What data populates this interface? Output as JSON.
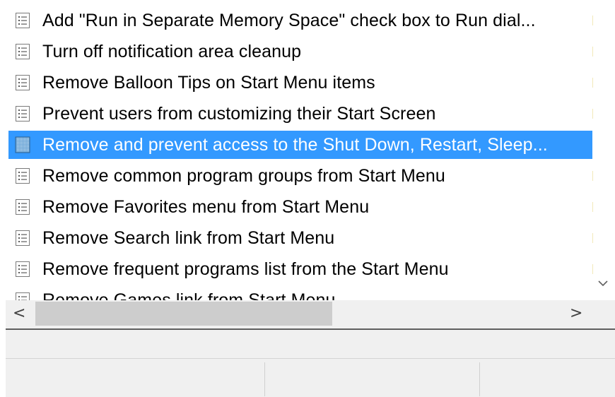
{
  "policy_list": {
    "items": [
      {
        "label": "Add \"Run in Separate Memory Space\" check box to Run dial...",
        "icon": "policy-setting-icon",
        "selected": false
      },
      {
        "label": "Turn off notification area cleanup",
        "icon": "policy-setting-icon",
        "selected": false
      },
      {
        "label": "Remove Balloon Tips on Start Menu items",
        "icon": "policy-setting-icon",
        "selected": false
      },
      {
        "label": "Prevent users from customizing their Start Screen",
        "icon": "policy-setting-icon",
        "selected": false
      },
      {
        "label": "Remove and prevent access to the Shut Down, Restart, Sleep...",
        "icon": "policy-setting-icon",
        "selected": true
      },
      {
        "label": "Remove common program groups from Start Menu",
        "icon": "policy-setting-icon",
        "selected": false
      },
      {
        "label": "Remove Favorites menu from Start Menu",
        "icon": "policy-setting-icon",
        "selected": false
      },
      {
        "label": "Remove Search link from Start Menu",
        "icon": "policy-setting-icon",
        "selected": false
      },
      {
        "label": "Remove frequent programs list from the Start Menu",
        "icon": "policy-setting-icon",
        "selected": false
      },
      {
        "label": "Remove Games link from Start Menu",
        "icon": "policy-setting-icon",
        "selected": false
      }
    ]
  },
  "scrollbars": {
    "horizontal": {
      "left_arrow": "<",
      "right_arrow": ">",
      "left_icon": "chevron-left-icon",
      "right_icon": "chevron-right-icon"
    },
    "vertical": {
      "down_arrow": "⌄",
      "down_icon": "chevron-down-icon"
    }
  },
  "colors": {
    "selection": "#3399ff",
    "scrollbar_track": "#f0f0f0",
    "scrollbar_thumb": "#cdcdcd"
  },
  "statusbar": {
    "panes": [
      "",
      "",
      ""
    ]
  }
}
